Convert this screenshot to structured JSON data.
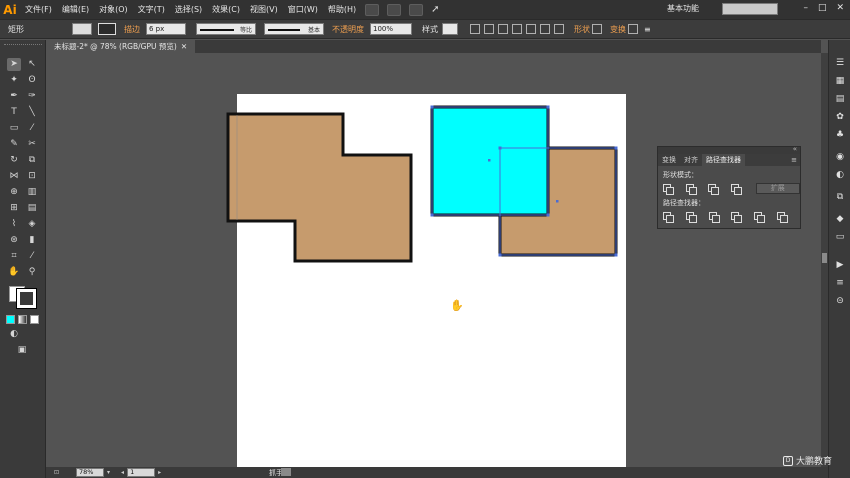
{
  "app": {
    "logo": "Ai",
    "menus": [
      "文件(F)",
      "编辑(E)",
      "对象(O)",
      "文字(T)",
      "选择(S)",
      "效果(C)",
      "视图(V)",
      "窗口(W)",
      "帮助(H)"
    ],
    "workspace": "基本功能",
    "window_controls": [
      "–",
      "□",
      "✕"
    ]
  },
  "control_bar": {
    "object_type": "矩形",
    "stroke_label": "描边",
    "stroke_weight": "6 px",
    "profile_label": "等比",
    "brush_label": "基本",
    "opacity_label": "不透明度",
    "opacity_value": "100%",
    "style_label": "样式",
    "shape_label": "形状",
    "transform_label": "变换"
  },
  "document": {
    "tab_title": "未标题-2* @ 78% (RGB/GPU 预览)",
    "close": "✕"
  },
  "pathfinder_panel": {
    "tabs": [
      "变换",
      "对齐",
      "路径查找器"
    ],
    "active_tab": "路径查找器",
    "shape_modes_label": "形状模式：",
    "pathfinders_label": "路径查找器：",
    "expand_button": "扩展",
    "menu_icon": "≡",
    "collapse_icon": "«"
  },
  "status_bar": {
    "zoom": "78%",
    "page": "1",
    "tool": "抓手"
  },
  "artwork": {
    "tan_color": "#c69b6d",
    "cyan_color": "#00ffff",
    "stroke_color": "#111111",
    "selection_color": "#4a6cd4"
  },
  "watermark": "大鹏教育"
}
